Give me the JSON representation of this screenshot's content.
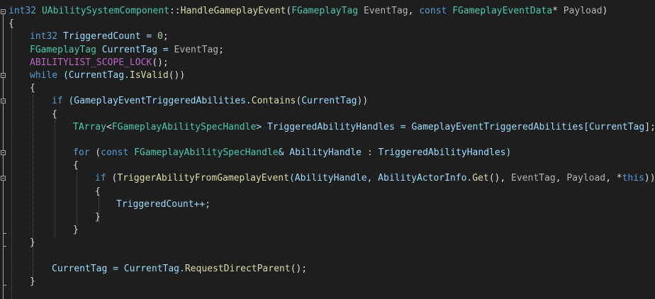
{
  "editor": {
    "line1": {
      "t1": "int32",
      "t2": " ",
      "t3": "UAbilitySystemComponent",
      "t4": "::",
      "t5": "HandleGameplayEvent",
      "t6": "(",
      "t7": "FGameplayTag",
      "t8": " ",
      "t9": "EventTag",
      "t10": ", ",
      "t11": "const",
      "t12": " ",
      "t13": "FGameplayEventData",
      "t14": "* ",
      "t15": "Payload",
      "t16": ")"
    },
    "line2": {
      "t1": "{"
    },
    "line3": {
      "t1": "int32",
      "t2": " TriggeredCount = ",
      "t3": "0",
      "t4": ";"
    },
    "line4": {
      "t1": "FGameplayTag",
      "t2": " CurrentTag = ",
      "t3": "EventTag",
      "t4": ";"
    },
    "line5": {
      "t1": "ABILITYLIST_SCOPE_LOCK",
      "t2": "();"
    },
    "line6": {
      "t1": "while",
      "t2": " (CurrentTag.",
      "t3": "IsValid",
      "t4": "())"
    },
    "line7": {
      "t1": "{"
    },
    "line8": {
      "t1": "if",
      "t2": " (GameplayEventTriggeredAbilities.",
      "t3": "Contains",
      "t4": "(",
      "t5": "CurrentTag",
      "t6": "))"
    },
    "line9": {
      "t1": "{"
    },
    "line10": {
      "t1": "TArray",
      "t2": "<",
      "t3": "FGameplayAbilitySpecHandle",
      "t4": "> TriggeredAbilityHandles = GameplayEventTriggeredAbilities[",
      "t5": "CurrentTag",
      "t6": "];"
    },
    "line12": {
      "t1": "for",
      "t2": " (",
      "t3": "const",
      "t4": " ",
      "t5": "FGameplayAbilitySpecHandle",
      "t6": "& AbilityHandle : TriggeredAbilityHandles)"
    },
    "line13": {
      "t1": "{"
    },
    "line14": {
      "t1": "if",
      "t2": " (",
      "t3": "TriggerAbilityFromGameplayEvent",
      "t4": "(AbilityHandle, AbilityActorInfo.",
      "t5": "Get",
      "t6": "(), ",
      "t7": "EventTag",
      "t8": ", ",
      "t9": "Payload",
      "t10": ", *",
      "t11": "this",
      "t12": "))"
    },
    "line15": {
      "t1": "{"
    },
    "line16": {
      "t1": "TriggeredCount++;"
    },
    "line17": {
      "t1": "}"
    },
    "line18": {
      "t1": "}"
    },
    "line19": {
      "t1": "}"
    },
    "line21": {
      "t1": "CurrentTag = CurrentTag.",
      "t2": "RequestDirectParent",
      "t3": "();"
    },
    "line22": {
      "t1": "}"
    }
  }
}
